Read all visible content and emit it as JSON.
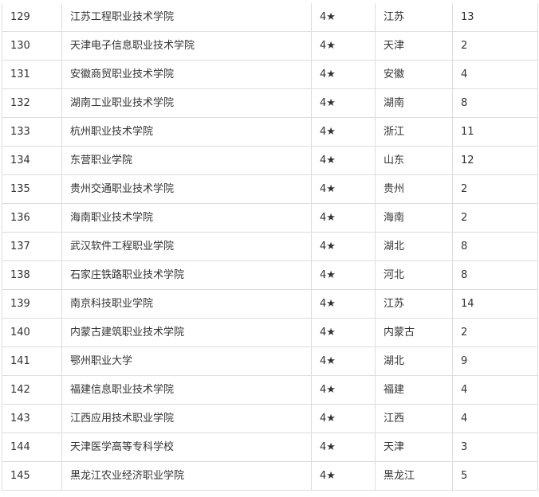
{
  "rows": [
    {
      "rank": "129",
      "name": "江苏工程职业技术学院",
      "stars": "4★",
      "province": "江苏",
      "count": "13"
    },
    {
      "rank": "130",
      "name": "天津电子信息职业技术学院",
      "stars": "4★",
      "province": "天津",
      "count": "2"
    },
    {
      "rank": "131",
      "name": "安徽商贸职业技术学院",
      "stars": "4★",
      "province": "安徽",
      "count": "4"
    },
    {
      "rank": "132",
      "name": "湖南工业职业技术学院",
      "stars": "4★",
      "province": "湖南",
      "count": "8"
    },
    {
      "rank": "133",
      "name": "杭州职业技术学院",
      "stars": "4★",
      "province": "浙江",
      "count": "11"
    },
    {
      "rank": "134",
      "name": "东营职业学院",
      "stars": "4★",
      "province": "山东",
      "count": "12"
    },
    {
      "rank": "135",
      "name": "贵州交通职业技术学院",
      "stars": "4★",
      "province": "贵州",
      "count": "2"
    },
    {
      "rank": "136",
      "name": "海南职业技术学院",
      "stars": "4★",
      "province": "海南",
      "count": "2"
    },
    {
      "rank": "137",
      "name": "武汉软件工程职业学院",
      "stars": "4★",
      "province": "湖北",
      "count": "8"
    },
    {
      "rank": "138",
      "name": "石家庄铁路职业技术学院",
      "stars": "4★",
      "province": "河北",
      "count": "8"
    },
    {
      "rank": "139",
      "name": "南京科技职业学院",
      "stars": "4★",
      "province": "江苏",
      "count": "14"
    },
    {
      "rank": "140",
      "name": "内蒙古建筑职业技术学院",
      "stars": "4★",
      "province": "内蒙古",
      "count": "2"
    },
    {
      "rank": "141",
      "name": "鄂州职业大学",
      "stars": "4★",
      "province": "湖北",
      "count": "9"
    },
    {
      "rank": "142",
      "name": "福建信息职业技术学院",
      "stars": "4★",
      "province": "福建",
      "count": "4"
    },
    {
      "rank": "143",
      "name": "江西应用技术职业学院",
      "stars": "4★",
      "province": "江西",
      "count": "4"
    },
    {
      "rank": "144",
      "name": "天津医学高等专科学校",
      "stars": "4★",
      "province": "天津",
      "count": "3"
    },
    {
      "rank": "145",
      "name": "黑龙江农业经济职业学院",
      "stars": "4★",
      "province": "黑龙江",
      "count": "5"
    }
  ]
}
